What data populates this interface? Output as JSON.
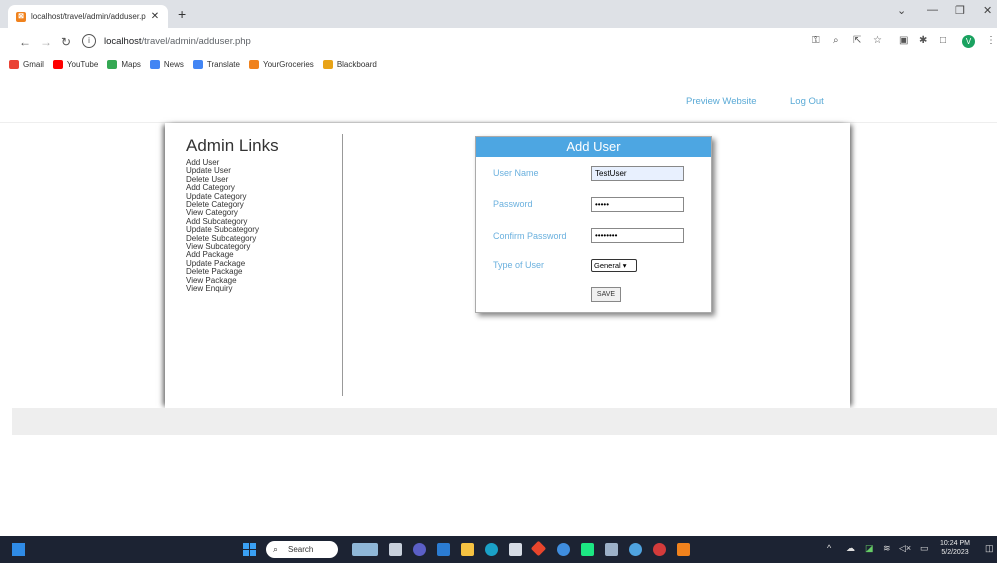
{
  "browser": {
    "tab_title": "localhost/travel/admin/adduser.p",
    "tab_close": "✕",
    "new_tab": "+",
    "url_host": "localhost",
    "url_path": "/travel/admin/adduser.php",
    "window_controls": [
      "⌄",
      "—",
      "❐",
      "✕"
    ],
    "bookmarks": [
      {
        "label": "Gmail",
        "color": "#ea4335"
      },
      {
        "label": "YouTube",
        "color": "#ff0000"
      },
      {
        "label": "Maps",
        "color": "#34a853"
      },
      {
        "label": "News",
        "color": "#4285f4"
      },
      {
        "label": "Translate",
        "color": "#4285f4"
      },
      {
        "label": "YourGroceries",
        "color": "#f0821d"
      },
      {
        "label": "Blackboard",
        "color": "#e8a317"
      }
    ],
    "profile_initial": "V"
  },
  "header": {
    "preview_link": "Preview Website",
    "logout_link": "Log Out"
  },
  "sidebar": {
    "title": "Admin Links",
    "links": [
      "Add User",
      "Update User",
      "Delete User",
      "Add Category",
      "Update Category",
      "Delete Category",
      "View Category",
      "Add Subcategory",
      "Update Subcategory",
      "Delete Subcategory",
      "View Subcategory",
      "Add Package",
      "Update Package",
      "Delete Package",
      "View Package",
      "View Enquiry"
    ]
  },
  "form": {
    "title": "Add User",
    "username_label": "User Name",
    "username_value": "TestUser",
    "password_label": "Password",
    "password_value": "•••••",
    "confirm_label": "Confirm Password",
    "confirm_value": "••••••••",
    "type_label": "Type of User",
    "type_value": "General ▾",
    "save_label": "SAVE"
  },
  "taskbar": {
    "search_placeholder": "Search",
    "time": "10:24 PM",
    "date": "5/2/2023"
  },
  "colors": {
    "accent": "#4da6e2",
    "link": "#5aaad6",
    "taskbar": "#1c2333"
  }
}
